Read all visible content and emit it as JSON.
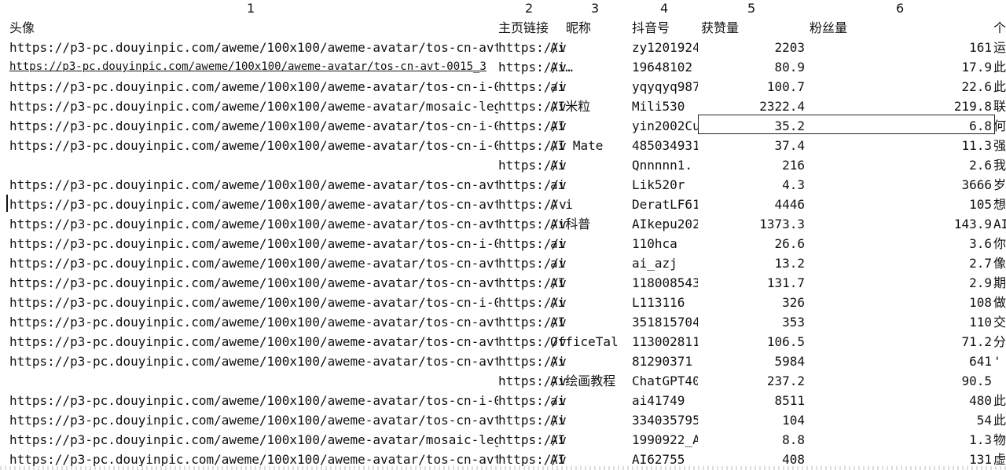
{
  "column_numbers": [
    "1",
    "2",
    "3",
    "4",
    "5",
    "6"
  ],
  "headers": {
    "avatar": "头像",
    "link": "主页链接",
    "nick": "昵称",
    "douyin_id": "抖音号",
    "likes": "获赞量",
    "fans": "粉丝量",
    "bio": "个"
  },
  "rows": [
    {
      "avatar": "https://p3-pc.douyinpic.com/aweme/100x100/aweme-avatar/tos-cn-avt",
      "link": "https://v",
      "nick": "Ai",
      "douyin_id": "zy1201924",
      "likes": "2203",
      "fans": "161",
      "bio": "运"
    },
    {
      "avatar": "https://p3-pc.douyinpic.com/aweme/100x100/aweme-avatar/tos-cn-avt-0015_3",
      "link": "https://v",
      "nick": "Ai…",
      "douyin_id": "19648102",
      "likes": "80.9",
      "fans": "17.9",
      "bio": "此"
    },
    {
      "avatar": "https://p3-pc.douyinpic.com/aweme/100x100/aweme-avatar/tos-cn-i-0",
      "link": "https://v",
      "nick": "ai",
      "douyin_id": "yqyqyq987",
      "likes": "100.7",
      "fans": "22.6",
      "bio": "此"
    },
    {
      "avatar": "https://p3-pc.douyinpic.com/aweme/100x100/aweme-avatar/mosaic-leg",
      "link": "https://v",
      "nick": "AI米粒",
      "douyin_id": "Mili530",
      "likes": "2322.4",
      "fans": "219.8",
      "bio": "联"
    },
    {
      "avatar": "https://p3-pc.douyinpic.com/aweme/100x100/aweme-avatar/tos-cn-i-0",
      "link": "https://v",
      "nick": "AI",
      "douyin_id": "yin2002Cu",
      "likes": "35.2",
      "fans": "6.8",
      "bio": "何"
    },
    {
      "avatar": "https://p3-pc.douyinpic.com/aweme/100x100/aweme-avatar/tos-cn-i-0",
      "link": "https://v",
      "nick": "AI Mate",
      "douyin_id": "485034931",
      "likes": "37.4",
      "fans": "11.3",
      "bio": "强"
    },
    {
      "avatar": "",
      "link": "https://v",
      "nick": "Ai",
      "douyin_id": "Qnnnnn1.",
      "likes": "216",
      "fans": "2.6",
      "bio": "我"
    },
    {
      "avatar": "https://p3-pc.douyinpic.com/aweme/100x100/aweme-avatar/tos-cn-avt",
      "link": "https://v",
      "nick": "ai",
      "douyin_id": "Lik520r",
      "likes": "4.3",
      "fans": "3666",
      "bio": "岁"
    },
    {
      "avatar": "https://p3-pc.douyinpic.com/aweme/100x100/aweme-avatar/tos-cn-avt",
      "link": "https://v",
      "nick": "A i",
      "douyin_id": "DeratLF61",
      "likes": "4446",
      "fans": "105",
      "bio": "想"
    },
    {
      "avatar": "https://p3-pc.douyinpic.com/aweme/100x100/aweme-avatar/tos-cn-avt",
      "link": "https://v",
      "nick": "Ai科普",
      "douyin_id": "AIkepu202",
      "likes": "1373.3",
      "fans": "143.9",
      "bio": "AI"
    },
    {
      "avatar": "https://p3-pc.douyinpic.com/aweme/100x100/aweme-avatar/tos-cn-i-0",
      "link": "https://v",
      "nick": "ai",
      "douyin_id": "110hca",
      "likes": "26.6",
      "fans": "3.6",
      "bio": "你"
    },
    {
      "avatar": "https://p3-pc.douyinpic.com/aweme/100x100/aweme-avatar/tos-cn-avt",
      "link": "https://v",
      "nick": "ai",
      "douyin_id": "ai_azj",
      "likes": "13.2",
      "fans": "2.7",
      "bio": "像"
    },
    {
      "avatar": "https://p3-pc.douyinpic.com/aweme/100x100/aweme-avatar/tos-cn-avt",
      "link": "https://v",
      "nick": "AI",
      "douyin_id": "118008543",
      "likes": "131.7",
      "fans": "2.9",
      "bio": "期"
    },
    {
      "avatar": "https://p3-pc.douyinpic.com/aweme/100x100/aweme-avatar/tos-cn-i-0",
      "link": "https://v",
      "nick": "Ai",
      "douyin_id": "L113116",
      "likes": "326",
      "fans": "108",
      "bio": "做"
    },
    {
      "avatar": "https://p3-pc.douyinpic.com/aweme/100x100/aweme-avatar/tos-cn-avt",
      "link": "https://v",
      "nick": "AI",
      "douyin_id": "351815704",
      "likes": "353",
      "fans": "110",
      "bio": "交"
    },
    {
      "avatar": "https://p3-pc.douyinpic.com/aweme/100x100/aweme-avatar/tos-cn-avt",
      "link": "https://v",
      "nick": "OfficeTal",
      "douyin_id": "113002811",
      "likes": "106.5",
      "fans": "71.2",
      "bio": "分"
    },
    {
      "avatar": "https://p3-pc.douyinpic.com/aweme/100x100/aweme-avatar/tos-cn-avt",
      "link": "https://v",
      "nick": "Ai",
      "douyin_id": "81290371",
      "likes": "5984",
      "fans": "641",
      "bio": "'"
    },
    {
      "avatar": "",
      "link": "https://v",
      "nick": "Ai绘画教程",
      "douyin_id": "ChatGPT40",
      "likes": "237.2",
      "fans": "90.5",
      "bio": ""
    },
    {
      "avatar": "https://p3-pc.douyinpic.com/aweme/100x100/aweme-avatar/tos-cn-i-0",
      "link": "https://v",
      "nick": "ai",
      "douyin_id": "ai41749",
      "likes": "8511",
      "fans": "480",
      "bio": "此"
    },
    {
      "avatar": "https://p3-pc.douyinpic.com/aweme/100x100/aweme-avatar/tos-cn-avt",
      "link": "https://v",
      "nick": "Ai",
      "douyin_id": "334035795",
      "likes": "104",
      "fans": "54",
      "bio": "此"
    },
    {
      "avatar": "https://p3-pc.douyinpic.com/aweme/100x100/aweme-avatar/mosaic-leg",
      "link": "https://v",
      "nick": "AI",
      "douyin_id": "1990922_A",
      "likes": "8.8",
      "fans": "1.3",
      "bio": "物"
    },
    {
      "avatar": "https://p3-pc.douyinpic.com/aweme/100x100/aweme-avatar/tos-cn-avt",
      "link": "https://v",
      "nick": "AI",
      "douyin_id": "AI62755",
      "likes": "408",
      "fans": "131",
      "bio": "虚"
    }
  ]
}
